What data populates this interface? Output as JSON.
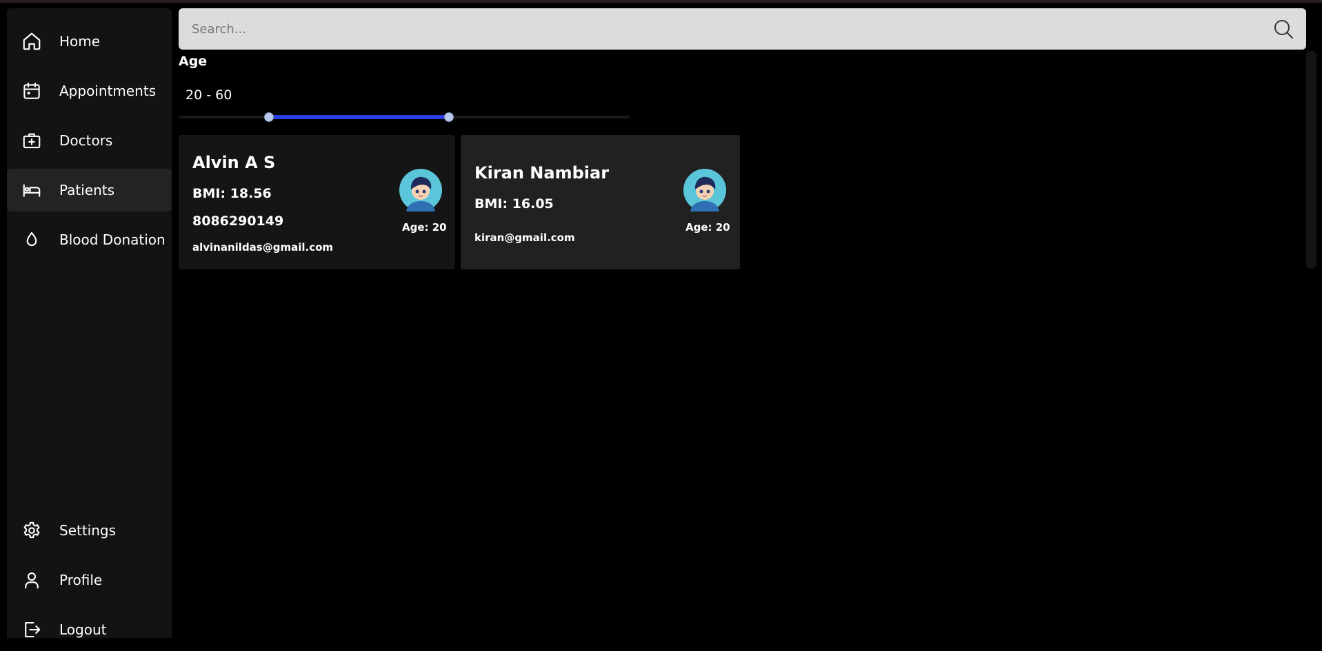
{
  "sidebar": {
    "top_items": [
      {
        "label": "Home",
        "icon": "home-icon"
      },
      {
        "label": "Appointments",
        "icon": "calendar-icon"
      },
      {
        "label": "Doctors",
        "icon": "medical-bag-icon"
      },
      {
        "label": "Patients",
        "icon": "bed-icon",
        "active": true
      },
      {
        "label": "Blood Donation",
        "icon": "drop-icon"
      }
    ],
    "bottom_items": [
      {
        "label": "Settings",
        "icon": "gear-icon"
      },
      {
        "label": "Profile",
        "icon": "user-icon"
      },
      {
        "label": "Logout",
        "icon": "logout-icon"
      }
    ]
  },
  "search": {
    "placeholder": "Search...",
    "value": ""
  },
  "filter": {
    "title": "Age",
    "range_label": "20 - 60",
    "min": 20,
    "max": 60,
    "scale_min": 0,
    "scale_max": 100
  },
  "patients": [
    {
      "name": "Alvin A S",
      "bmi": "BMI: 18.56",
      "phone": "8086290149",
      "email": "alvinanildas@gmail.com",
      "age": "Age: 20"
    },
    {
      "name": "Kiran Nambiar",
      "bmi": "BMI: 16.05",
      "email": "kiran@gmail.com",
      "age": "Age: 20"
    }
  ],
  "colors": {
    "background": "#000000",
    "sidebar": "#131313",
    "active_nav": "#232323",
    "slider_fill": "#2a3fe0",
    "card": "#151515",
    "card_hover": "#212121"
  }
}
